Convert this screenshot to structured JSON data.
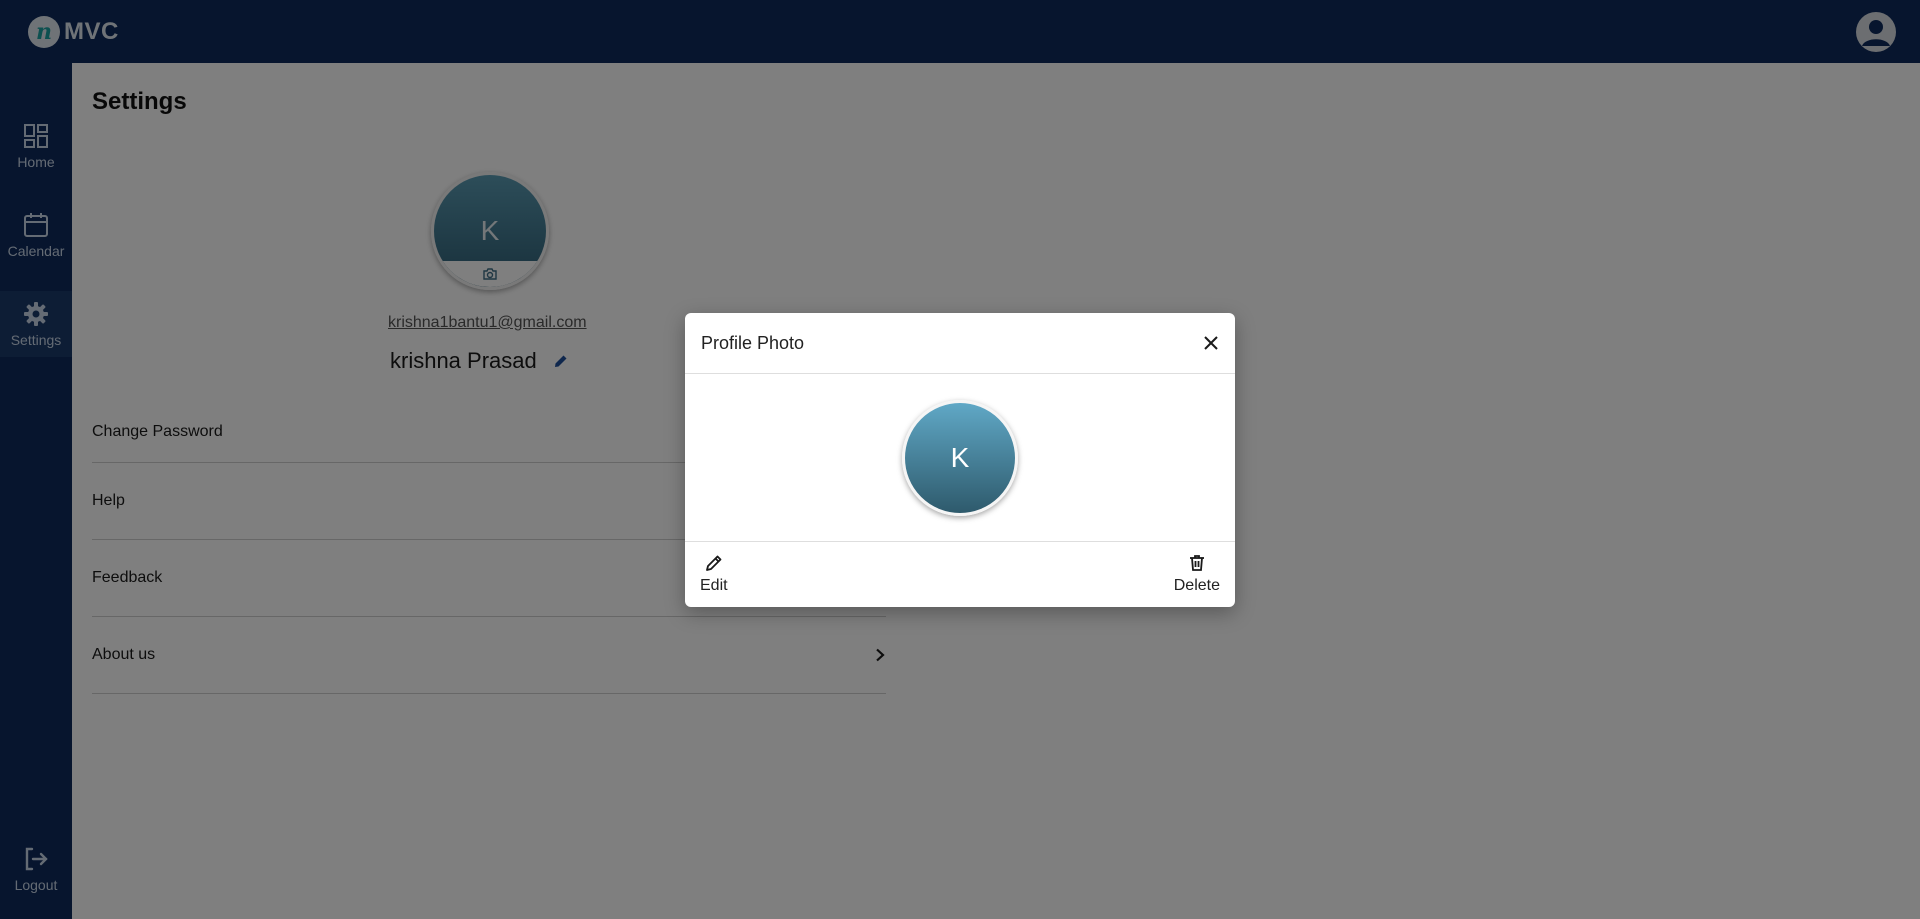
{
  "app": {
    "brand": "MVC",
    "colors": {
      "nav_bg": "#0e2b5c",
      "nav_active": "#1b3b6a",
      "avatar_accent": "#3f7d96",
      "edit_icon": "#1f4f9a"
    }
  },
  "topbar": {
    "account_icon": "account-circle-icon"
  },
  "sidebar": {
    "items": [
      {
        "label": "Home",
        "icon": "dashboard-icon"
      },
      {
        "label": "Calendar",
        "icon": "calendar-icon"
      },
      {
        "label": "Settings",
        "icon": "gear-icon",
        "active": true
      }
    ],
    "logout": {
      "label": "Logout",
      "icon": "logout-icon"
    }
  },
  "settings": {
    "title": "Settings",
    "avatar_initial": "K",
    "email": "krishna1bantu1@gmail.com",
    "name": "krishna Prasad",
    "menu": [
      {
        "label": "Change Password"
      },
      {
        "label": "Help"
      },
      {
        "label": "Feedback"
      },
      {
        "label": "About us",
        "icon": "chevron-right-icon"
      }
    ]
  },
  "modal": {
    "title": "Profile Photo",
    "avatar_initial": "K",
    "edit_label": "Edit",
    "delete_label": "Delete"
  }
}
